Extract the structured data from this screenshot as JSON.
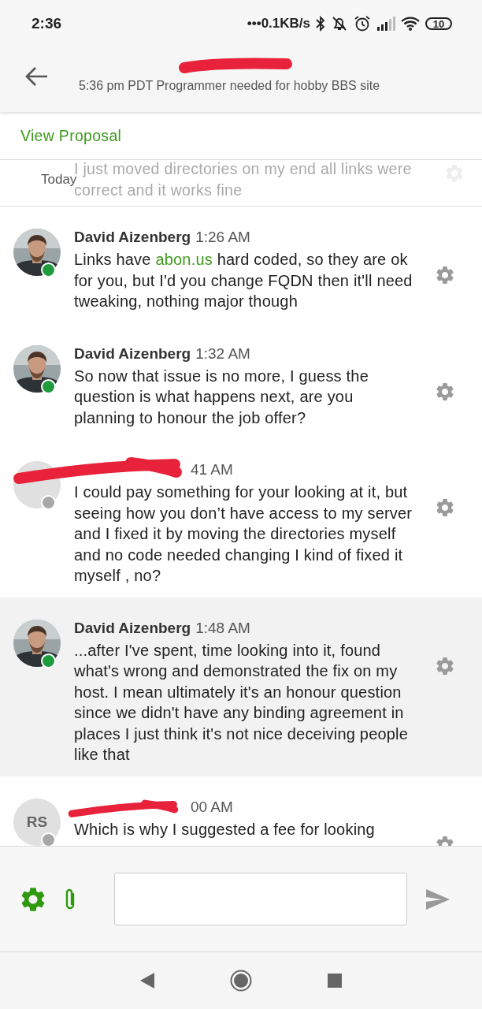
{
  "status_bar": {
    "time": "2:36",
    "network_speed": "•••0.1KB/s",
    "battery": "10"
  },
  "header": {
    "subtitle": "5:36 pm PDT Programmer needed for hobby BBS site"
  },
  "view_proposal": "View Proposal",
  "faded_row": {
    "date_label": "Today",
    "message": "I just moved directories on my end all links were correct and it works fine"
  },
  "messages": [
    {
      "sender": "David Aizenberg",
      "time": "1:26 AM",
      "online": true,
      "highlighted": false,
      "redacted": false,
      "parts": [
        {
          "text": "Links have "
        },
        {
          "text": "abon.us",
          "kind": "link"
        },
        {
          "text": " hard coded, so they are ok for you, but I'd you change FQDN then it'll need tweaking, nothing major though"
        }
      ]
    },
    {
      "sender": "David Aizenberg",
      "time": "1:32 AM",
      "online": true,
      "highlighted": false,
      "redacted": false,
      "parts": [
        {
          "text": "So now that issue is no more, I guess the question is what happens next, are you planning to honour the job offer?"
        }
      ]
    },
    {
      "kind": "initials",
      "time": "41 AM",
      "online": false,
      "highlighted": false,
      "redacted": true,
      "parts": [
        {
          "text": "I could pay something for your looking at it, but seeing how you don’t have access to my server and I fixed it by moving the directories myself and no code needed changing I kind of fixed it myself , no?"
        }
      ]
    },
    {
      "sender": "David Aizenberg",
      "time": "1:48 AM",
      "online": true,
      "highlighted": true,
      "redacted": false,
      "parts": [
        {
          "text": "...after I've spent, time looking into it, found what's wrong and demonstrated the fix on my host. I mean ultimately it's an honour question since we didn't have any binding agreement in places I just think it's not nice deceiving people like that"
        }
      ]
    },
    {
      "kind": "initials",
      "initials": "RS",
      "time": "00 AM",
      "online": false,
      "highlighted": false,
      "redacted": true,
      "parts": [
        {
          "text": "Which is why I suggested a fee for looking"
        }
      ]
    }
  ]
}
